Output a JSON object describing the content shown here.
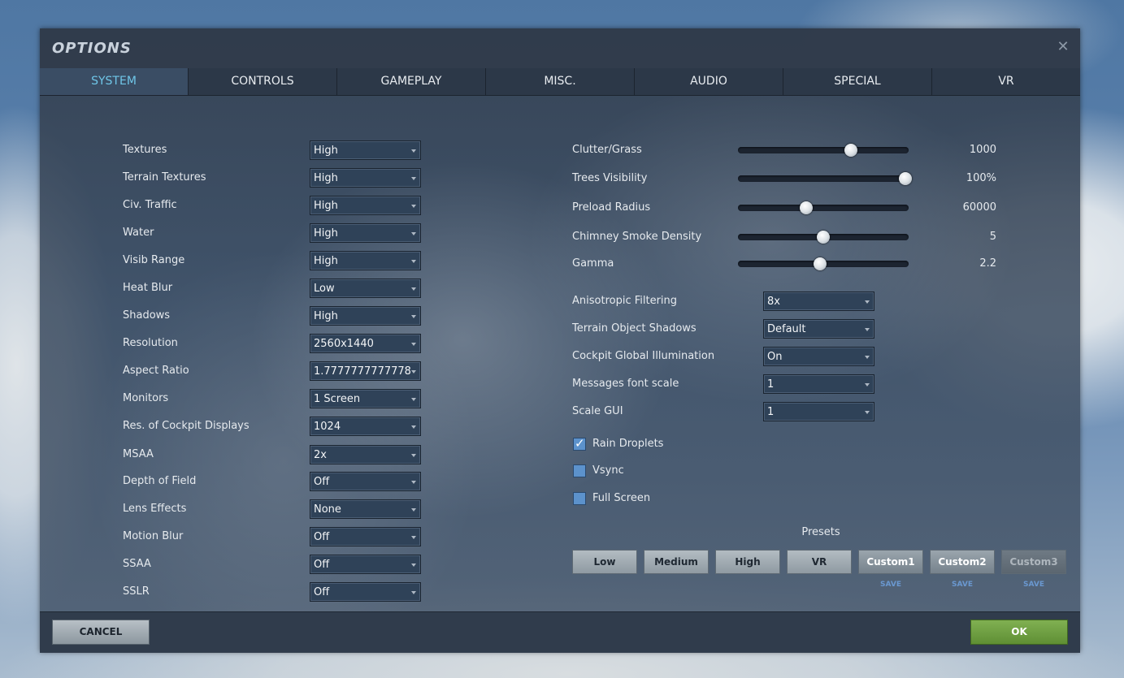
{
  "window": {
    "title": "OPTIONS",
    "close_icon": "close-icon"
  },
  "tabs": [
    {
      "label": "SYSTEM",
      "active": true
    },
    {
      "label": "CONTROLS",
      "active": false
    },
    {
      "label": "GAMEPLAY",
      "active": false
    },
    {
      "label": "MISC.",
      "active": false
    },
    {
      "label": "AUDIO",
      "active": false
    },
    {
      "label": "SPECIAL",
      "active": false
    },
    {
      "label": "VR",
      "active": false
    }
  ],
  "left_settings": [
    {
      "label": "Textures",
      "value": "High"
    },
    {
      "label": "Terrain Textures",
      "value": "High"
    },
    {
      "label": "Civ. Traffic",
      "value": "High"
    },
    {
      "label": "Water",
      "value": "High"
    },
    {
      "label": "Visib Range",
      "value": "High"
    },
    {
      "label": "Heat Blur",
      "value": "Low"
    },
    {
      "label": "Shadows",
      "value": "High"
    },
    {
      "label": "Resolution",
      "value": "2560x1440"
    },
    {
      "label": "Aspect Ratio",
      "value": "1.7777777777778"
    },
    {
      "label": "Monitors",
      "value": "1 Screen"
    },
    {
      "label": "Res. of Cockpit Displays",
      "value": "1024"
    },
    {
      "label": "MSAA",
      "value": "2x"
    },
    {
      "label": "Depth of Field",
      "value": "Off"
    },
    {
      "label": "Lens Effects",
      "value": "None"
    },
    {
      "label": "Motion Blur",
      "value": "Off"
    },
    {
      "label": "SSAA",
      "value": "Off"
    },
    {
      "label": "SSLR",
      "value": "Off"
    }
  ],
  "sliders": [
    {
      "label": "Clutter/Grass",
      "value": "1000",
      "fraction": 0.66
    },
    {
      "label": "Trees Visibility",
      "value": "100%",
      "fraction": 0.98
    },
    {
      "label": "Preload Radius",
      "value": "60000",
      "fraction": 0.4
    },
    {
      "label": "Chimney Smoke Density",
      "value": "5",
      "fraction": 0.5
    },
    {
      "label": "Gamma",
      "value": "2.2",
      "fraction": 0.48
    }
  ],
  "right_settings": [
    {
      "label": "Anisotropic Filtering",
      "value": "8x"
    },
    {
      "label": "Terrain Object Shadows",
      "value": "Default"
    },
    {
      "label": "Cockpit Global Illumination",
      "value": "On"
    },
    {
      "label": "Messages font scale",
      "value": "1"
    },
    {
      "label": "Scale GUI",
      "value": "1"
    }
  ],
  "checkboxes": [
    {
      "label": "Rain Droplets",
      "checked": true
    },
    {
      "label": "Vsync",
      "checked": false
    },
    {
      "label": "Full Screen",
      "checked": false
    }
  ],
  "presets": {
    "title": "Presets",
    "buttons": [
      "Low",
      "Medium",
      "High",
      "VR",
      "Custom1",
      "Custom2",
      "Custom3"
    ],
    "save_label": "SAVE"
  },
  "footer": {
    "cancel_label": "CANCEL",
    "ok_label": "OK"
  },
  "colors": {
    "active_tab": "#6fc6e8",
    "ok_button": "#6fa043",
    "checkbox": "#5c92cc"
  }
}
